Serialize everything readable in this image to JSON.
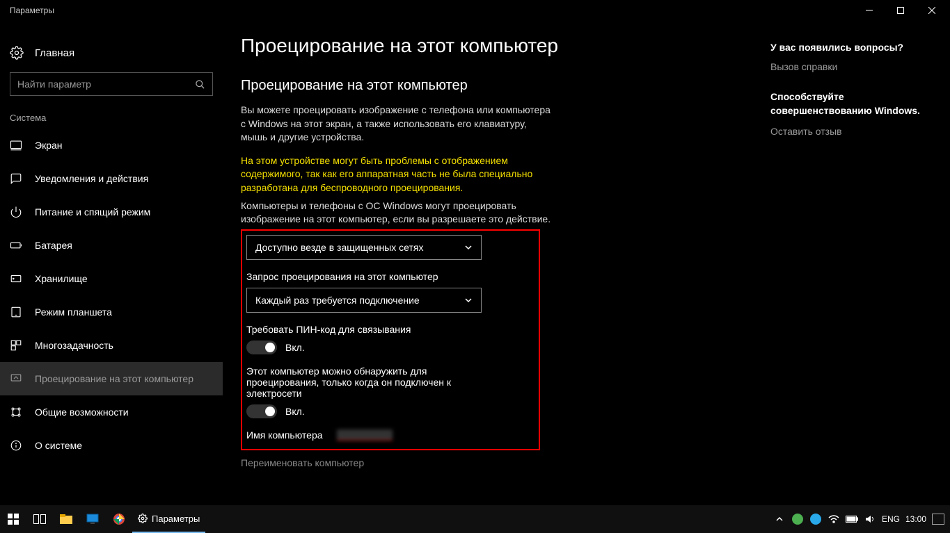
{
  "window": {
    "title": "Параметры"
  },
  "sidebar": {
    "home": "Главная",
    "search_placeholder": "Найти параметр",
    "category": "Система",
    "items": [
      {
        "id": "display",
        "label": "Экран"
      },
      {
        "id": "notifications",
        "label": "Уведомления и действия"
      },
      {
        "id": "power",
        "label": "Питание и спящий режим"
      },
      {
        "id": "battery",
        "label": "Батарея"
      },
      {
        "id": "storage",
        "label": "Хранилище"
      },
      {
        "id": "tablet",
        "label": "Режим планшета"
      },
      {
        "id": "multitask",
        "label": "Многозадачность"
      },
      {
        "id": "projecting",
        "label": "Проецирование на этот компьютер"
      },
      {
        "id": "shared",
        "label": "Общие возможности"
      },
      {
        "id": "about",
        "label": "О системе"
      }
    ]
  },
  "main": {
    "page_title": "Проецирование на этот компьютер",
    "section_title": "Проецирование на этот компьютер",
    "intro": "Вы можете проецировать изображение с телефона или компьютера с Windows на этот экран, а также использовать его клавиатуру, мышь и другие устройства.",
    "warning": "На этом устройстве могут быть проблемы с отображением содержимого, так как его аппаратная часть не была специально разработана для беспроводного проецирования.",
    "allow_label_line": "Компьютеры и телефоны с ОС Windows могут проецировать изображение на этот компьютер, если вы разрешаете это действие.",
    "dropdown1_value": "Доступно везде в защищенных сетях",
    "ask_label": "Запрос проецирования на этот компьютер",
    "dropdown2_value": "Каждый раз требуется подключение",
    "pin_label": "Требовать ПИН-код для связывания",
    "pin_state": "Вкл.",
    "plugged_label": "Этот компьютер можно обнаружить для проецирования, только когда он подключен к электросети",
    "plugged_state": "Вкл.",
    "pcname_label": "Имя компьютера",
    "rename": "Переименовать компьютер"
  },
  "right": {
    "q_title": "У вас появились вопросы?",
    "q_link": "Вызов справки",
    "improve_title": "Способствуйте совершенствованию Windows.",
    "improve_link": "Оставить отзыв"
  },
  "taskbar": {
    "app_label": "Параметры",
    "lang": "ENG",
    "time": "13:00"
  }
}
